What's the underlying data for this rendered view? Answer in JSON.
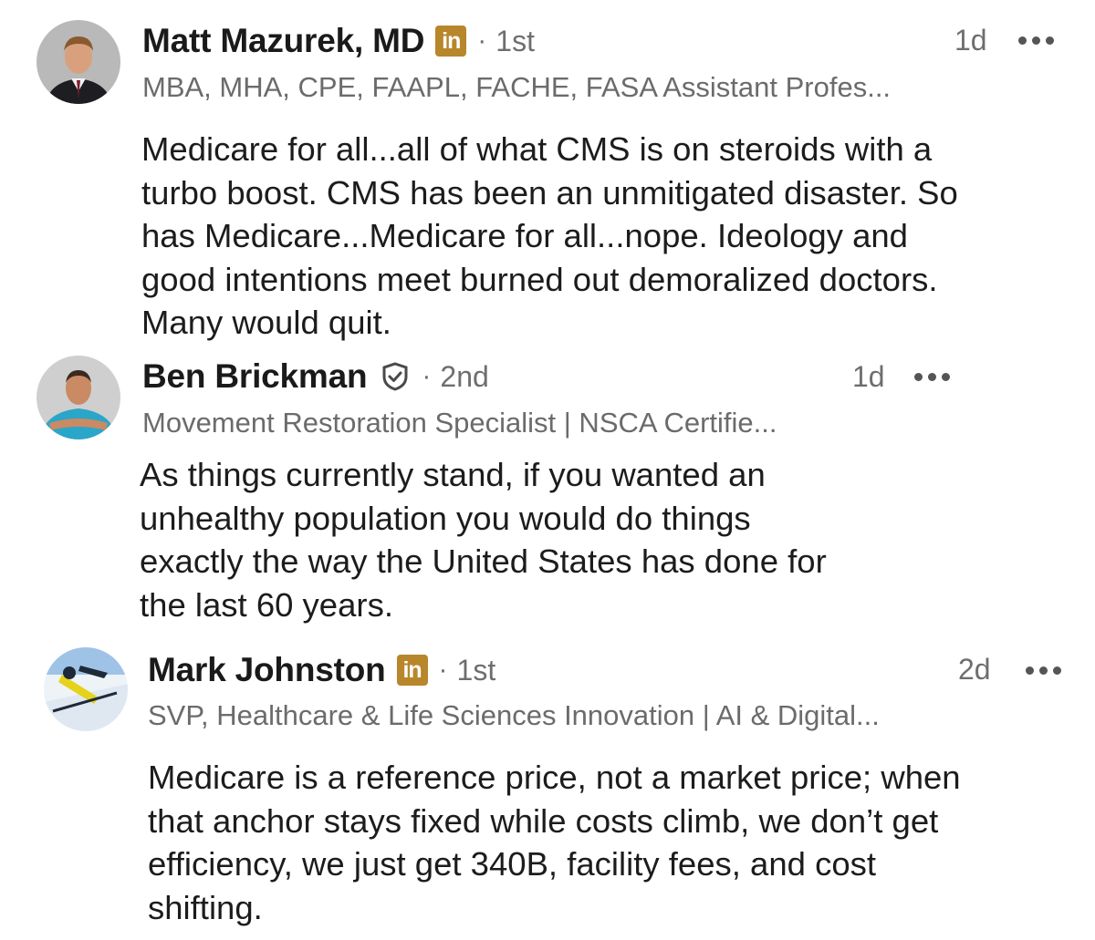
{
  "comments": [
    {
      "author": "Matt Mazurek, MD",
      "badge": "in",
      "badge_color": "#b8862b",
      "degree": "1st",
      "separator": "·",
      "time": "1d",
      "headline": "MBA, MHA, CPE, FAAPL, FACHE, FASA Assistant Profes...",
      "text": "Medicare for all...all of what CMS is on steroids with a\nturbo boost. CMS has been an unmitigated disaster. So\nhas Medicare...Medicare for all...nope. Ideology and\ngood intentions meet burned out demoralized doctors.\nMany would quit.",
      "more_icon": "more-horizontal-icon"
    },
    {
      "author": "Ben Brickman",
      "badge_icon": "verified-shield-icon",
      "degree": "2nd",
      "separator": "·",
      "time": "1d",
      "headline": "Movement Restoration Specialist | NSCA Certifie...",
      "text": "As things currently stand, if you wanted an\nunhealthy population you would do things\nexactly the way the United States has done for\nthe last 60 years.",
      "more_icon": "more-horizontal-icon"
    },
    {
      "author": "Mark Johnston",
      "badge": "in",
      "badge_color": "#b8862b",
      "degree": "1st",
      "separator": "·",
      "time": "2d",
      "headline": "SVP, Healthcare & Life Sciences Innovation | AI & Digital...",
      "text": "Medicare is a reference price, not a market price; when\nthat anchor stays fixed while costs climb, we don’t get\nefficiency, we just get 340B, facility fees, and cost\nshifting.",
      "more_icon": "more-horizontal-icon"
    }
  ]
}
